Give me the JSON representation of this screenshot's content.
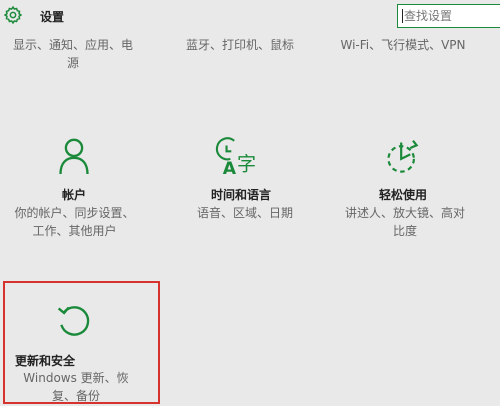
{
  "header": {
    "title": "设置",
    "search_placeholder": "查找设置"
  },
  "top_row": [
    {
      "desc_line1": "显示、通知、应用、电",
      "desc_line2": "源"
    },
    {
      "desc_line1": "蓝牙、打印机、鼠标"
    },
    {
      "desc_line1": "Wi-Fi、飞行模式、VPN"
    }
  ],
  "tiles": [
    {
      "title": "帐户",
      "desc_line1": "你的帐户、同步设置、",
      "desc_line2": "工作、其他用户",
      "icon": "person-icon"
    },
    {
      "title": "时间和语言",
      "desc_line1": "语音、区域、日期",
      "icon": "time-language-icon"
    },
    {
      "title": "轻松使用",
      "desc_line1": "讲述人、放大镜、高对",
      "desc_line2": "比度",
      "icon": "ease-of-access-icon"
    },
    {
      "title": "更新和安全",
      "desc_line1": "Windows 更新、恢",
      "desc_line2": "复、备份",
      "icon": "update-icon"
    }
  ],
  "colors": {
    "accent": "#1a8a3a",
    "background": "#e9e9e9",
    "highlight_border": "#d6332f"
  }
}
